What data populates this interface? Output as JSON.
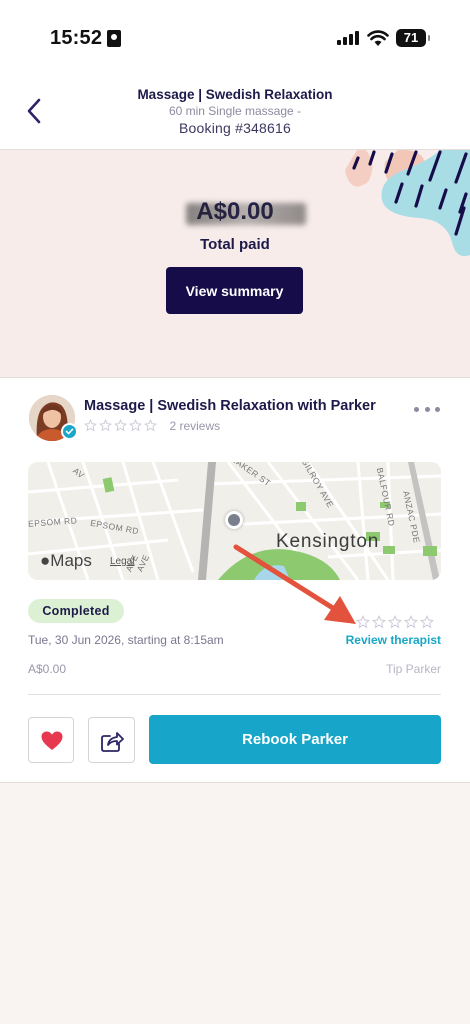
{
  "status_bar": {
    "time": "15:52",
    "battery": "71"
  },
  "header": {
    "title": "Massage | Swedish Relaxation",
    "subtitle": "60 min Single massage -",
    "booking": "Booking #348616"
  },
  "summary": {
    "amount": "A$0.00",
    "total_label": "Total paid",
    "view_summary_label": "View summary"
  },
  "therapist_card": {
    "title": "Massage  |  Swedish Relaxation with Parker",
    "rating_stars": 0,
    "reviews": "2 reviews",
    "map": {
      "suburb_label": "Kensington",
      "maps_logo": "Maps",
      "legal": "Legal",
      "streets": [
        "BAKER ST",
        "GILROY AVE",
        "BALFOUR RD",
        "ANZAC PDE",
        "EPSOM RD",
        "EPSOM RD",
        "AV",
        "AVE",
        "AVE"
      ]
    },
    "status_badge": "Completed",
    "date": "Tue, 30 Jun 2026, starting at 8:15am",
    "price": "A$0.00",
    "review_label": "Review therapist",
    "tip_label": "Tip Parker",
    "rebook_label": "Rebook Parker"
  },
  "icons": {
    "back": "chevron-left-icon",
    "more": "more-horizontal-icon",
    "favorite": "heart-icon",
    "share": "share-icon",
    "verified": "verified-check-icon"
  },
  "colors": {
    "navy": "#160c49",
    "teal": "#17a6c9",
    "heart": "#e63950",
    "annotation_arrow": "#e2523c",
    "completed_badge": "#dcf1d4"
  }
}
